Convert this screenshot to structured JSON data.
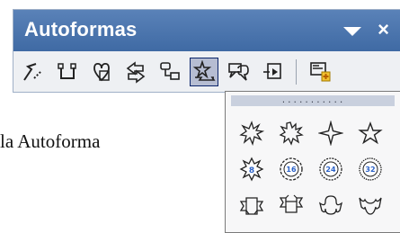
{
  "window": {
    "title": "Autoformas"
  },
  "background_text": "la Autoforma",
  "toolbar": {
    "items": [
      {
        "name": "lines-button",
        "icon": "lines-icon"
      },
      {
        "name": "connectors-button",
        "icon": "connectors-icon"
      },
      {
        "name": "basic-shapes-button",
        "icon": "basic-shapes-icon"
      },
      {
        "name": "block-arrows-button",
        "icon": "block-arrows-icon"
      },
      {
        "name": "flowchart-button",
        "icon": "flowchart-icon"
      },
      {
        "name": "stars-banners-button",
        "icon": "stars-banners-icon",
        "active": true
      },
      {
        "name": "callouts-button",
        "icon": "callouts-icon"
      },
      {
        "name": "action-buttons-button",
        "icon": "action-buttons-icon"
      },
      {
        "name": "more-autoshapes-button",
        "icon": "more-autoshapes-icon"
      }
    ]
  },
  "menu": {
    "grip_label": "...........",
    "shapes": [
      "explosion-1-icon",
      "explosion-2-icon",
      "four-point-star-icon",
      "five-point-star-icon",
      "eight-point-star-icon",
      "sixteen-point-star-icon",
      "twenty-four-point-star-icon",
      "thirty-two-point-star-icon",
      "up-ribbon-icon",
      "down-ribbon-icon",
      "curved-up-ribbon-icon",
      "curved-down-ribbon-icon"
    ],
    "star_labels": {
      "s8": "8",
      "s16": "16",
      "s24": "24",
      "s32": "32"
    }
  },
  "colors": {
    "titlebar": "#4a74ad",
    "active_border": "#0a246a",
    "star_fill": "#3a78d8"
  }
}
